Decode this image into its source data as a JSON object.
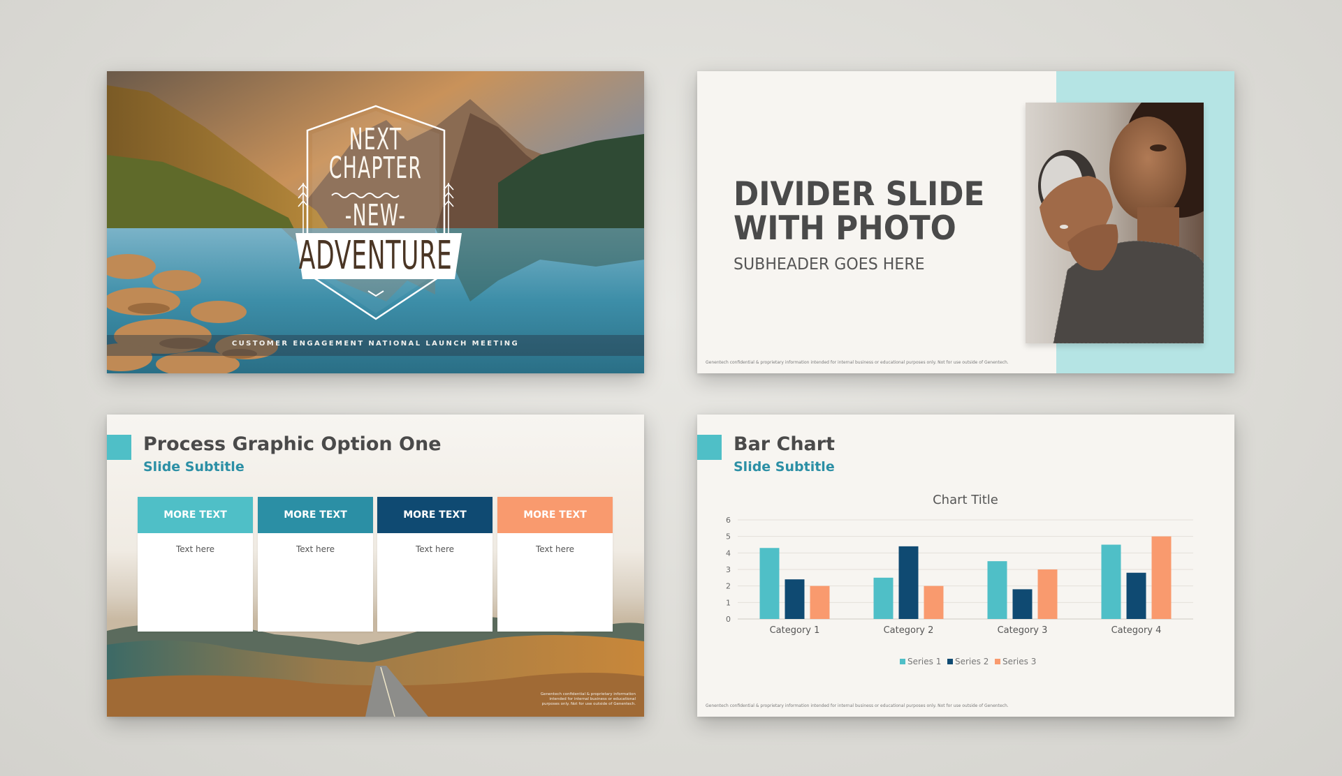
{
  "colors": {
    "teal": "#4fbfc7",
    "dark_teal": "#2b8fa5",
    "navy": "#0f4a72",
    "salmon": "#f99a6e",
    "divider_accent": "#b5e4e4",
    "slide_bg": "#f7f5f1"
  },
  "slide1": {
    "line1": "NEXT",
    "line2": "CHAPTER",
    "line3": "-NEW-",
    "line4": "ADVENTURE",
    "meeting": "CUSTOMER ENGAGEMENT NATIONAL LAUNCH MEETING"
  },
  "slide2": {
    "title_line1": "DIVIDER SLIDE",
    "title_line2": "WITH PHOTO",
    "subheader": "SUBHEADER GOES HERE",
    "confidential": "Genentech confidential & proprietary information intended for internal business or educational purposes only. Not for use outside of Genentech."
  },
  "slide3": {
    "title": "Process Graphic Option One",
    "subtitle": "Slide Subtitle",
    "boxes": [
      {
        "label": "MORE TEXT",
        "text": "Text here"
      },
      {
        "label": "MORE TEXT",
        "text": "Text here"
      },
      {
        "label": "MORE TEXT",
        "text": "Text here"
      },
      {
        "label": "MORE TEXT",
        "text": "Text here"
      }
    ],
    "confidential": "Genentech confidential & proprietary information intended for internal business or educational purposes only. Not for use outside of Genentech."
  },
  "slide4": {
    "title": "Bar Chart",
    "subtitle": "Slide Subtitle",
    "confidential": "Genentech confidential & proprietary information intended for internal business or educational purposes only. Not for use outside of Genentech."
  },
  "chart_data": {
    "type": "bar",
    "title": "Chart Title",
    "categories": [
      "Category 1",
      "Category 2",
      "Category 3",
      "Category 4"
    ],
    "series": [
      {
        "name": "Series 1",
        "values": [
          4.3,
          2.5,
          3.5,
          4.5
        ],
        "color": "#4fbfc7"
      },
      {
        "name": "Series 2",
        "values": [
          2.4,
          4.4,
          1.8,
          2.8
        ],
        "color": "#0f4a72"
      },
      {
        "name": "Series 3",
        "values": [
          2,
          2,
          3,
          5
        ],
        "color": "#f99a6e"
      }
    ],
    "yticks": [
      0,
      1,
      2,
      3,
      4,
      5,
      6
    ],
    "ylim": [
      0,
      6
    ],
    "xlabel": "",
    "ylabel": "",
    "legend_position": "bottom",
    "grid": true
  }
}
